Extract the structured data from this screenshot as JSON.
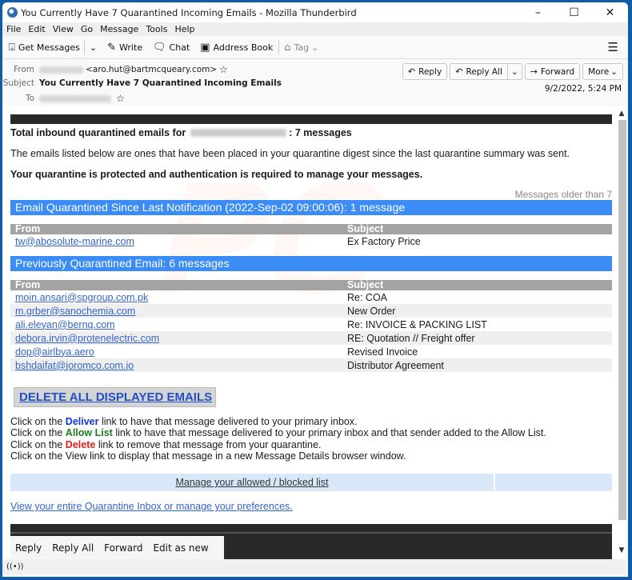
{
  "window": {
    "title": "You Currently Have 7 Quarantined Incoming Emails - Mozilla Thunderbird",
    "controls": {
      "minimize": "–",
      "maximize": "☐",
      "close": "✕"
    }
  },
  "menubar": [
    "File",
    "Edit",
    "View",
    "Go",
    "Message",
    "Tools",
    "Help"
  ],
  "toolbar": {
    "get_messages": "Get Messages",
    "write": "Write",
    "chat": "Chat",
    "address_book": "Address Book",
    "tag": "Tag"
  },
  "header": {
    "from_label": "From",
    "from_email": "<aro.hut@bartmcqueary.com>",
    "subject_label": "Subject",
    "subject": "You Currently Have 7 Quarantined Incoming Emails",
    "to_label": "To",
    "date": "9/2/2022, 5:24 PM",
    "buttons": {
      "reply": "Reply",
      "reply_all": "Reply All",
      "forward": "Forward",
      "more": "More"
    }
  },
  "body": {
    "total_prefix": "Total inbound quarantined emails for",
    "total_suffix": ": 7 messages",
    "intro": "The emails listed below are ones that have been placed in your quarantine digest since the last quarantine summary was sent.",
    "auth_notice": "Your quarantine is protected and authentication is required to manage your messages.",
    "older_note": "Messages older than 7",
    "section1_title": "Email Quarantined Since Last Notification (2022-Sep-02 09:00:06): 1 message",
    "section2_title": "Previously Quarantined Email: 6 messages",
    "col_from": "From",
    "col_subject": "Subject",
    "recent": [
      {
        "from": "tw@abosolute-marine.com",
        "subject": "Ex Factory Price"
      }
    ],
    "previous": [
      {
        "from": "moin.ansari@spgroup.com.pk",
        "subject": "Re: COA"
      },
      {
        "from": "m.grber@sanochemia.com",
        "subject": "New Order"
      },
      {
        "from": "ali.eleyan@bernq.com",
        "subject": "Re: INVOICE & PACKING LIST"
      },
      {
        "from": "debora.irvin@protenelectric.com",
        "subject": "RE: Quotation // Freight offer"
      },
      {
        "from": "dop@airlbya.aero",
        "subject": "Revised Invoice"
      },
      {
        "from": "bshdaifat@joromco.com.jo",
        "subject": "Distributor Agreement"
      }
    ],
    "delete_all": "DELETE ALL DISPLAYED EMAILS",
    "instructions": {
      "click_on_the": "Click on the",
      "deliver": "Deliver",
      "deliver_rest": "link to have that message delivered to your primary inbox.",
      "allow": "Allow List",
      "allow_rest": "link to have that message delivered to your primary inbox and that sender added to the Allow List.",
      "delete": "Delete",
      "delete_rest": "link to remove that message from your quarantine.",
      "view_line": "Click on the View link to display that message in a new Message Details browser window."
    },
    "manage_link": "Manage your allowed / blocked list",
    "view_inbox_link": "View your entire Quarantine Inbox or manage your preferences."
  },
  "reply_bar": [
    "Reply",
    "Reply All",
    "Forward",
    "Edit as new"
  ],
  "statusbar": {
    "icon": "((•))"
  }
}
